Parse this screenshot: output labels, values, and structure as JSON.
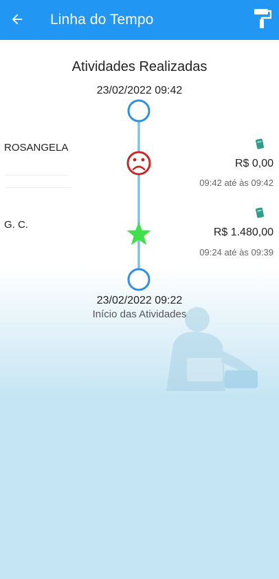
{
  "appbar": {
    "title": "Linha do Tempo",
    "back_icon": "arrow-left-icon",
    "action_icon": "paint-roller-icon",
    "color": "#2196f3"
  },
  "timeline": {
    "heading": "Atividades Realizadas",
    "end_datetime": "23/02/2022 09:42",
    "start_datetime": "23/02/2022 09:22",
    "start_label": "Início das Atividades",
    "line_color": "#7ec3e6",
    "node_color": "#2f8fe0",
    "entries": [
      {
        "name": "ROSANGELA",
        "value": "R$ 0,00",
        "period": "09:42 até às 09:42",
        "status_icon": "sad-face-icon",
        "status_color": "#c62828",
        "money_icon": "money-icon"
      },
      {
        "name": "G. C.",
        "value": "R$ 1.480,00",
        "period": "09:24 até às 09:39",
        "status_icon": "star-icon",
        "status_color": "#3fe04a",
        "money_icon": "money-icon"
      }
    ]
  }
}
